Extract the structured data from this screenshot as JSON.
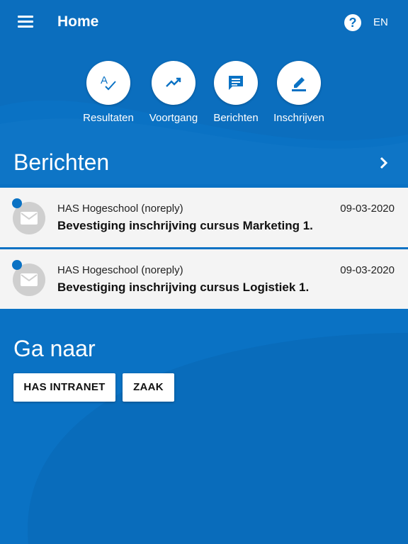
{
  "header": {
    "title": "Home",
    "help_icon": "help-circle-icon",
    "language": "EN"
  },
  "quick_actions": [
    {
      "label": "Resultaten",
      "icon": "spellcheck-icon"
    },
    {
      "label": "Voortgang",
      "icon": "trending-up-icon"
    },
    {
      "label": "Berichten",
      "icon": "message-icon"
    },
    {
      "label": "Inschrijven",
      "icon": "edit-icon"
    }
  ],
  "messages_section": {
    "title": "Berichten",
    "items": [
      {
        "sender": "HAS Hogeschool (noreply)",
        "date": "09-03-2020",
        "subject": "Bevestiging inschrijving cursus Marketing 1.",
        "unread": true
      },
      {
        "sender": "HAS Hogeschool (noreply)",
        "date": "09-03-2020",
        "subject": "Bevestiging inschrijving cursus Logistiek 1.",
        "unread": true
      }
    ]
  },
  "goto_section": {
    "title": "Ga naar",
    "buttons": [
      "HAS INTRANET",
      "ZAAK"
    ]
  },
  "colors": {
    "primary": "#0a72c4",
    "card": "#f4f4f4",
    "avatar": "#cfcfcf"
  }
}
